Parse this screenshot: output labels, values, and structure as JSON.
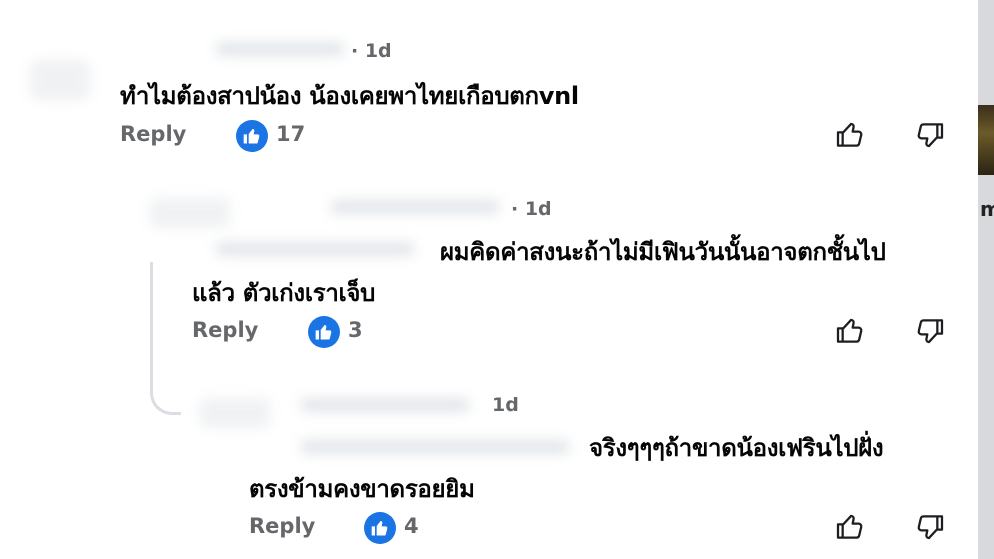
{
  "comments": [
    {
      "time": "· 1d",
      "lines": [
        "ทำไมต้องสาปน้อง น้องเคยพาไทยเกือบตกvnl"
      ],
      "reply_label": "Reply",
      "like_count": "17"
    },
    {
      "time": "· 1d",
      "lines": [
        "ผมคิดค่าสงนะถ้าไม่มีเฟินวันนั้นอาจตกชั้นไป",
        "แล้ว ตัวเก่งเราเจ็บ"
      ],
      "reply_label": "Reply",
      "like_count": "3"
    },
    {
      "time": "1d",
      "lines": [
        "จริงๆๆๆถ้าขาดน้องเฟรินไปฝั่ง",
        "ตรงข้ามคงขาดรอยยิม"
      ],
      "reply_label": "Reply",
      "like_count": "4"
    }
  ],
  "icons": {
    "like_badge": "thumbs-up-icon",
    "like_button": "thumbs-up-outline-icon",
    "dislike_button": "thumbs-down-outline-icon"
  },
  "colors": {
    "like_badge": "#1b74e4",
    "secondary_text": "#65676b",
    "primary_text": "#050505"
  }
}
